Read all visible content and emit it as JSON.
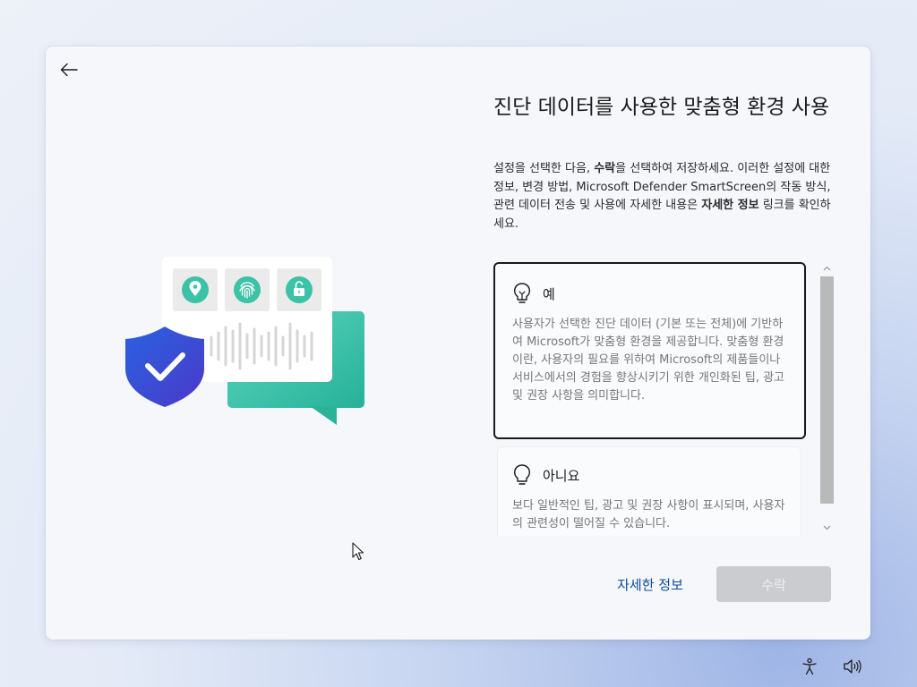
{
  "page": {
    "title": "진단 데이터를 사용한 맞춤형 환경 사용",
    "description_parts": [
      "설정을 선택한 다음, ",
      "수락",
      "을 선택하여 저장하세요. 이러한 설정에 대한 정보, 변경 방법, Microsoft Defender SmartScreen의 작동 방식, 관련 데이터 전송 및 사용에 자세한 내용은 ",
      "자세한 정보",
      " 링크를 확인하세요."
    ]
  },
  "options": [
    {
      "title": "예",
      "body": "사용자가 선택한 진단 데이터 (기본 또는 전체)에 기반하여 Microsoft가 맞춤형 환경을 제공합니다. 맞춤형 환경이란, 사용자의 필요를 위하여 Microsoft의 제품들이나 서비스에서의 경험을 향상시키기 위한 개인화된 팁, 광고 및 권장 사항을 의미합니다.",
      "icon": "lightbulb-on-icon",
      "selected": true
    },
    {
      "title": "아니요",
      "body": "보다 일반적인 팁, 광고 및 권장 사항이 표시되며, 사용자의 관련성이 떨어질 수 있습니다.",
      "icon": "lightbulb-off-icon",
      "selected": false
    }
  ],
  "buttons": {
    "learn_more": "자세한 정보",
    "accept": "수락"
  },
  "colors": {
    "link": "#0b4c9b",
    "shield": "#2f55d4",
    "chat_bubble": "#35c2a8",
    "disabled_button": "#cbcccf"
  },
  "tray": {
    "accessibility_icon": "accessibility-icon",
    "volume_icon": "volume-icon"
  }
}
